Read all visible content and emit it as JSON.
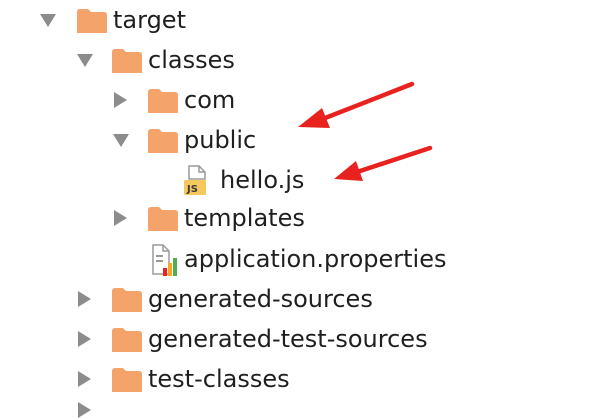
{
  "tree": {
    "items": [
      {
        "label": "target",
        "kind": "folder",
        "state": "expanded"
      },
      {
        "label": "classes",
        "kind": "folder",
        "state": "expanded"
      },
      {
        "label": "com",
        "kind": "folder",
        "state": "collapsed"
      },
      {
        "label": "public",
        "kind": "folder",
        "state": "expanded"
      },
      {
        "label": "hello.js",
        "kind": "js-file",
        "icon_text": "JS"
      },
      {
        "label": "templates",
        "kind": "folder",
        "state": "collapsed"
      },
      {
        "label": "application.properties",
        "kind": "properties-file"
      },
      {
        "label": "generated-sources",
        "kind": "folder",
        "state": "collapsed"
      },
      {
        "label": "generated-test-sources",
        "kind": "folder",
        "state": "collapsed"
      },
      {
        "label": "test-classes",
        "kind": "folder",
        "state": "collapsed"
      }
    ]
  },
  "colors": {
    "folder": "#F4A46A",
    "arrow": "#8C8C8C",
    "annotation_arrow": "#E8231F",
    "js_badge": "#F6C95C"
  },
  "icons": {
    "expand": "triangle-down-icon",
    "collapse": "triangle-right-icon",
    "folder": "folder-icon",
    "js": "js-file-icon",
    "properties": "properties-file-icon"
  }
}
